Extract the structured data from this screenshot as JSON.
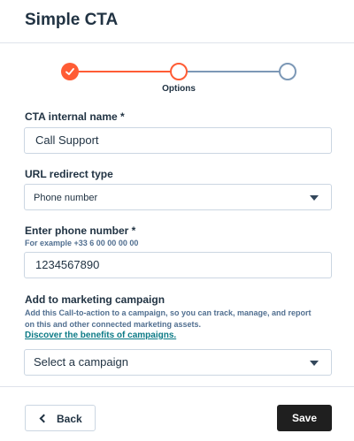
{
  "header": {
    "title": "Simple CTA"
  },
  "stepper": {
    "steps": [
      {
        "state": "complete"
      },
      {
        "state": "active",
        "label": "Options"
      },
      {
        "state": "pending"
      }
    ]
  },
  "form": {
    "cta_name": {
      "label": "CTA internal name *",
      "value": "Call Support"
    },
    "url_redirect": {
      "label": "URL redirect type",
      "value": "Phone number"
    },
    "phone": {
      "label": "Enter phone number *",
      "help": "For example +33 6 00 00 00 00",
      "value": "1234567890"
    },
    "campaign": {
      "label": "Add to marketing campaign",
      "help_line1": "Add this Call-to-action to a campaign, so you can track, manage, and report",
      "help_line2": "on this and other connected marketing assets.",
      "link": "Discover the benefits of campaigns.",
      "placeholder": "Select a campaign"
    }
  },
  "footer": {
    "back_label": "Back",
    "save_label": "Save"
  },
  "colors": {
    "accent": "#ff5c35",
    "primary_button": "#1f1f1f",
    "link": "#0b7a86"
  }
}
